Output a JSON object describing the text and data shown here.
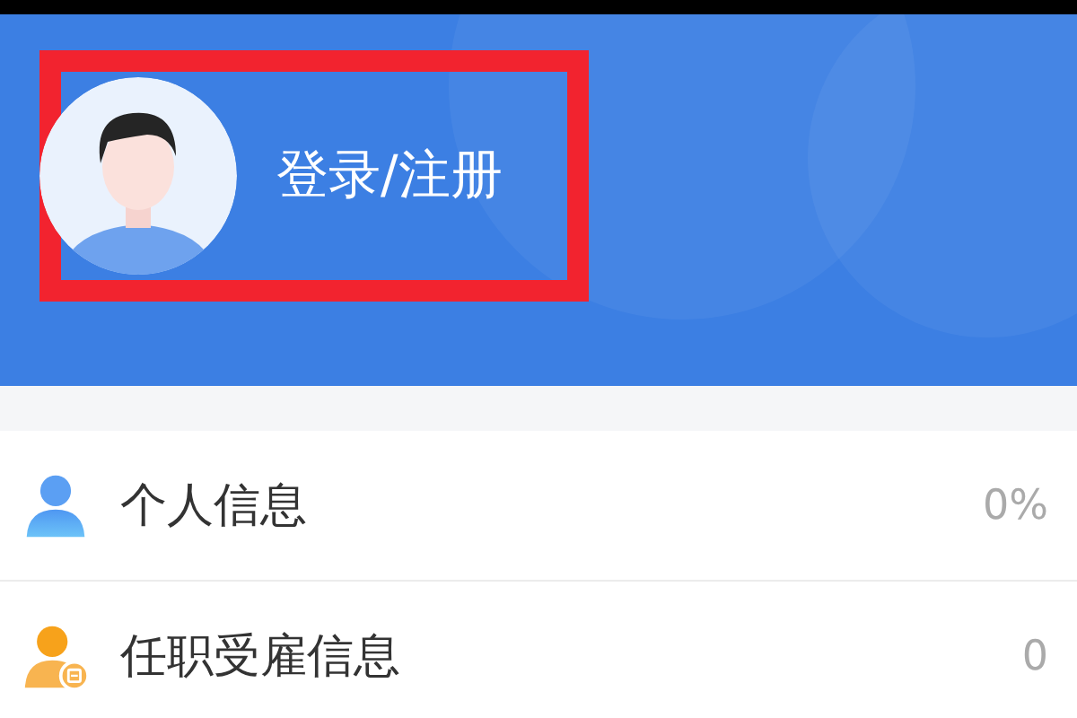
{
  "header": {
    "login_label": "登录/注册"
  },
  "menu_items": [
    {
      "label": "个人信息",
      "value": "0%"
    },
    {
      "label": "任职受雇信息",
      "value": "0"
    }
  ]
}
